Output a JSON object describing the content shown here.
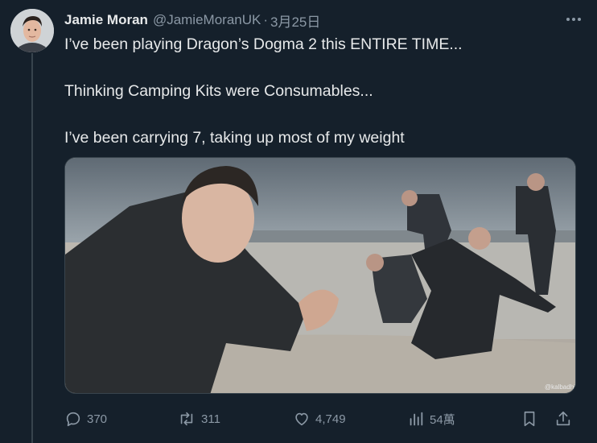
{
  "author": {
    "name": "Jamie Moran",
    "handle": "@JamieMoranUK",
    "separator": "·",
    "date": "3月25日"
  },
  "tweet": {
    "lines": [
      "I’ve been playing Dragon’s Dogma 2 this ENTIRE TIME...",
      "Thinking Camping Kits were Consumables...",
      "I’ve been carrying 7, taking up most of my weight"
    ]
  },
  "media": {
    "description_icon": "meme-image",
    "watermark": "@kalbadhit"
  },
  "actions": {
    "replies": "370",
    "retweets": "311",
    "likes": "4,749",
    "views": "54萬"
  },
  "colors": {
    "background": "#15202b",
    "text": "#e7e9ea",
    "muted": "#8b98a5",
    "border": "#38444d"
  },
  "icons": [
    "more-icon",
    "reply-icon",
    "retweet-icon",
    "like-icon",
    "views-icon",
    "bookmark-icon",
    "share-icon"
  ]
}
